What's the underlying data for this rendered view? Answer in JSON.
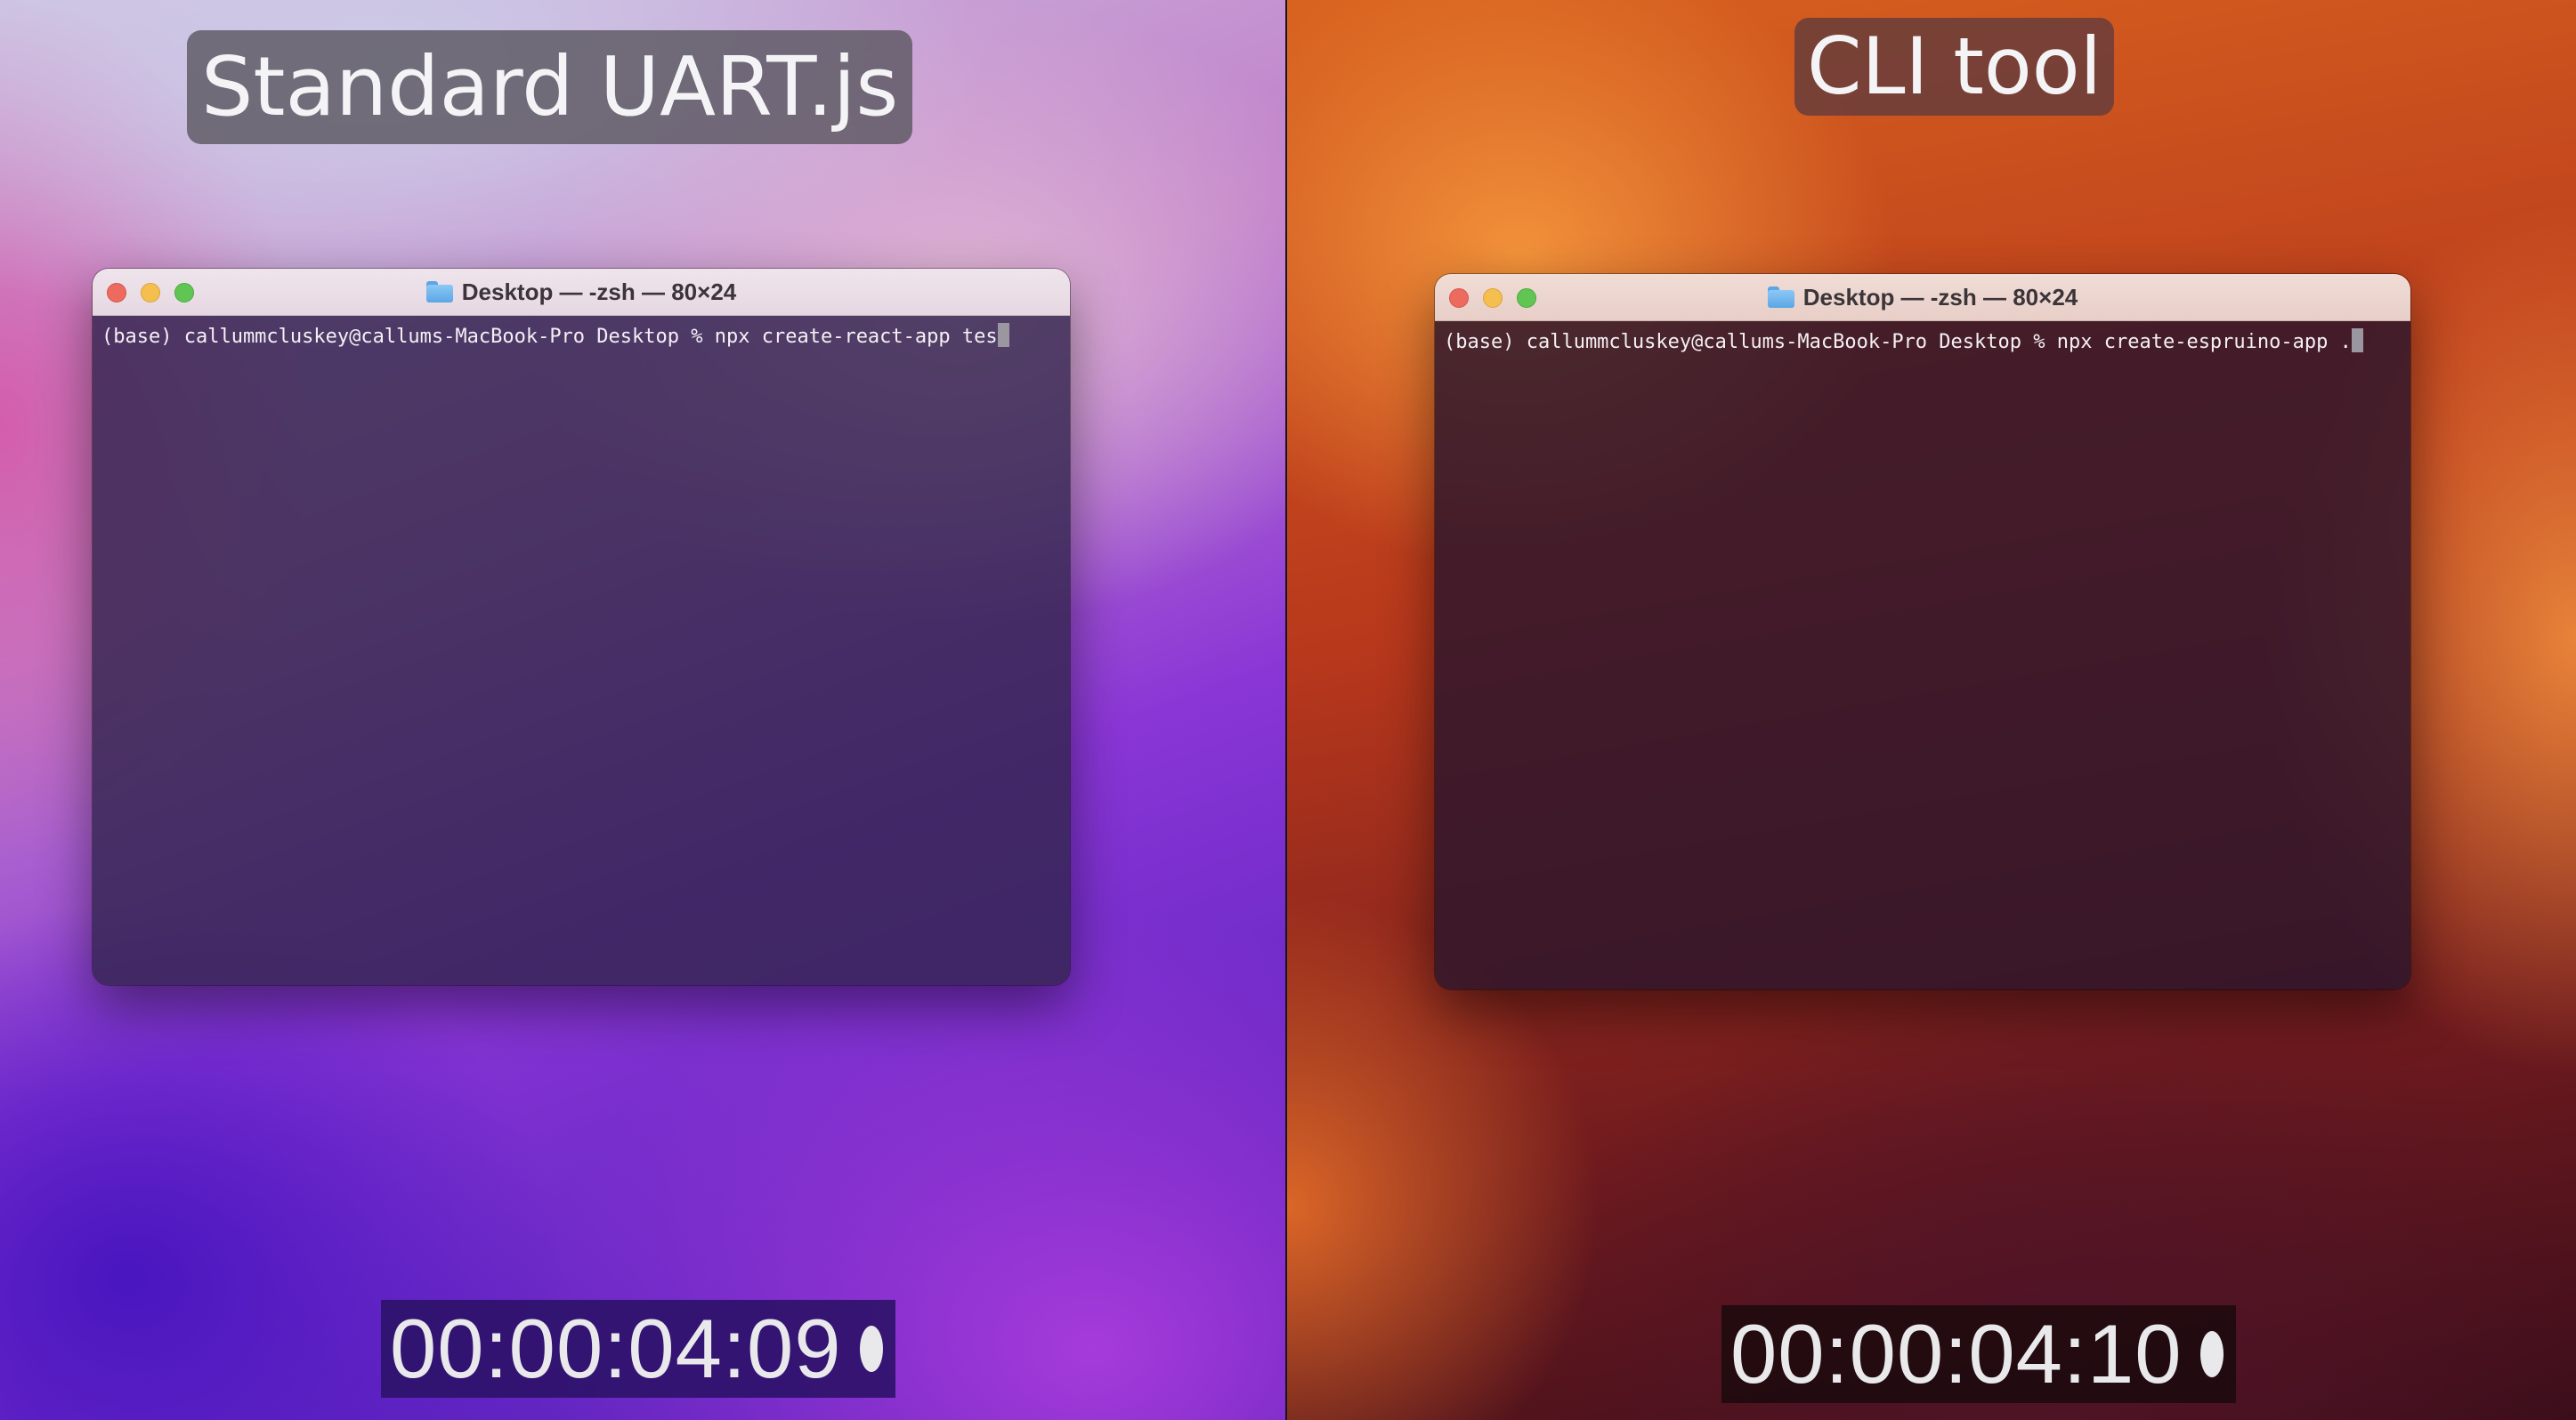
{
  "left_panel": {
    "caption": "Standard UART.js",
    "terminal": {
      "title": "Desktop — -zsh — 80×24",
      "prompt_line": "(base) callummcluskey@callums-MacBook-Pro Desktop % npx create-react-app tes"
    },
    "timecode": "00:00:04:09"
  },
  "right_panel": {
    "caption": "CLI tool",
    "terminal": {
      "title": "Desktop — -zsh — 80×24",
      "prompt_line": "(base) callummcluskey@callums-MacBook-Pro Desktop % npx create-espruino-app ."
    },
    "timecode": "00:00:04:10"
  },
  "icons": {
    "window_controls": [
      "close-icon",
      "minimize-icon",
      "zoom-icon"
    ],
    "title_icon": "folder-icon",
    "timer_indicator": "record-dot-icon"
  },
  "colors": {
    "close": "#ed6a5e",
    "minimize": "#f5bf4f",
    "zoom": "#61c554",
    "folder": "#5aa6e6"
  }
}
